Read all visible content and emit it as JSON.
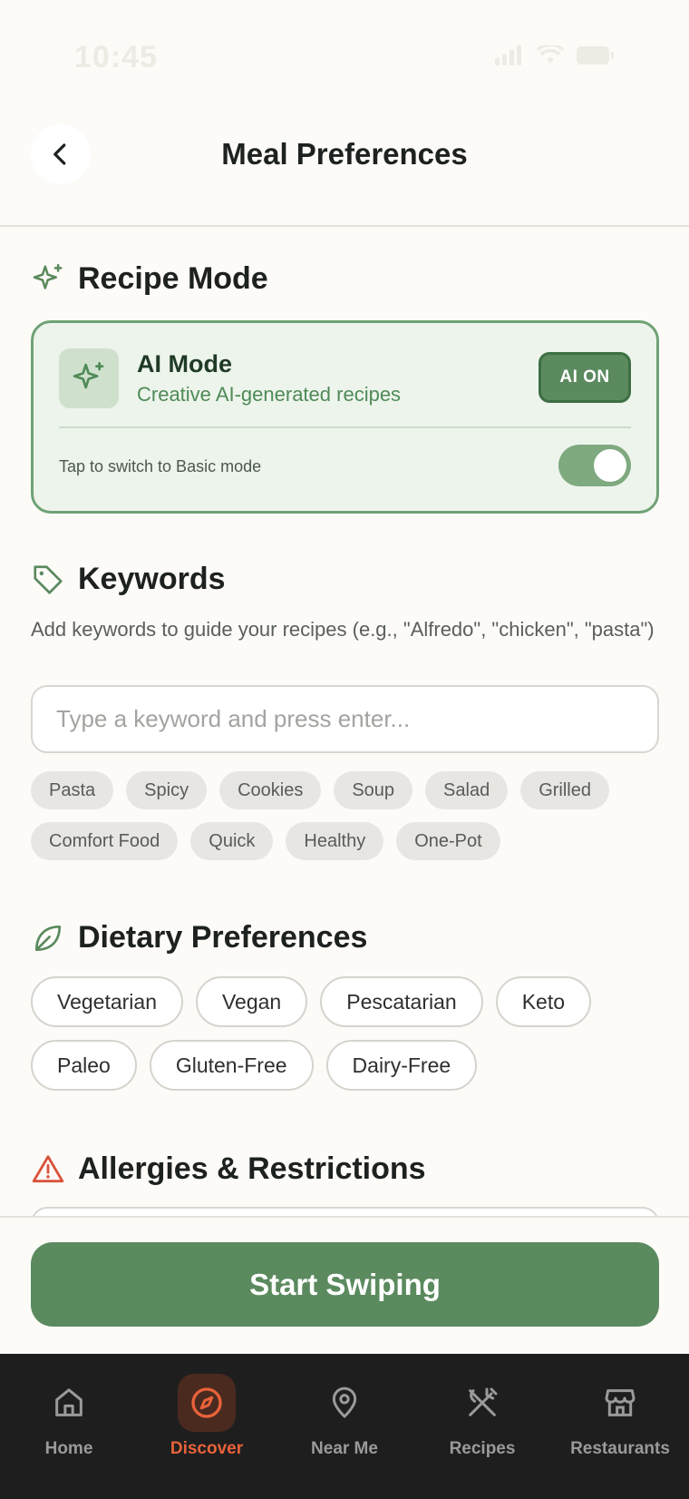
{
  "status": {
    "time": "10:45"
  },
  "header": {
    "title": "Meal Preferences"
  },
  "recipe_mode": {
    "section_title": "Recipe Mode",
    "mode_name": "AI Mode",
    "mode_description": "Creative AI-generated recipes",
    "badge": "AI ON",
    "switch_label": "Tap to switch to Basic mode",
    "toggle_on": true
  },
  "keywords": {
    "section_title": "Keywords",
    "description": "Add keywords to guide your recipes (e.g., \"Alfredo\", \"chicken\", \"pasta\")",
    "input_placeholder": "Type a keyword and press enter...",
    "suggestions": [
      "Pasta",
      "Spicy",
      "Cookies",
      "Soup",
      "Salad",
      "Grilled",
      "Comfort Food",
      "Quick",
      "Healthy",
      "One-Pot"
    ]
  },
  "dietary": {
    "section_title": "Dietary Preferences",
    "options": [
      "Vegetarian",
      "Vegan",
      "Pescatarian",
      "Keto",
      "Paleo",
      "Gluten-Free",
      "Dairy-Free"
    ]
  },
  "allergies": {
    "section_title": "Allergies & Restrictions"
  },
  "cta": {
    "label": "Start Swiping"
  },
  "tabbar": {
    "active": "Discover",
    "tabs": [
      {
        "label": "Home",
        "icon": "home-icon"
      },
      {
        "label": "Discover",
        "icon": "compass-icon"
      },
      {
        "label": "Near Me",
        "icon": "map-pin-icon"
      },
      {
        "label": "Recipes",
        "icon": "utensils-crossed-icon"
      },
      {
        "label": "Restaurants",
        "icon": "store-icon"
      }
    ]
  },
  "colors": {
    "primary": "#5b8a5f",
    "accent": "#e8623a",
    "warning": "#d9533a"
  }
}
